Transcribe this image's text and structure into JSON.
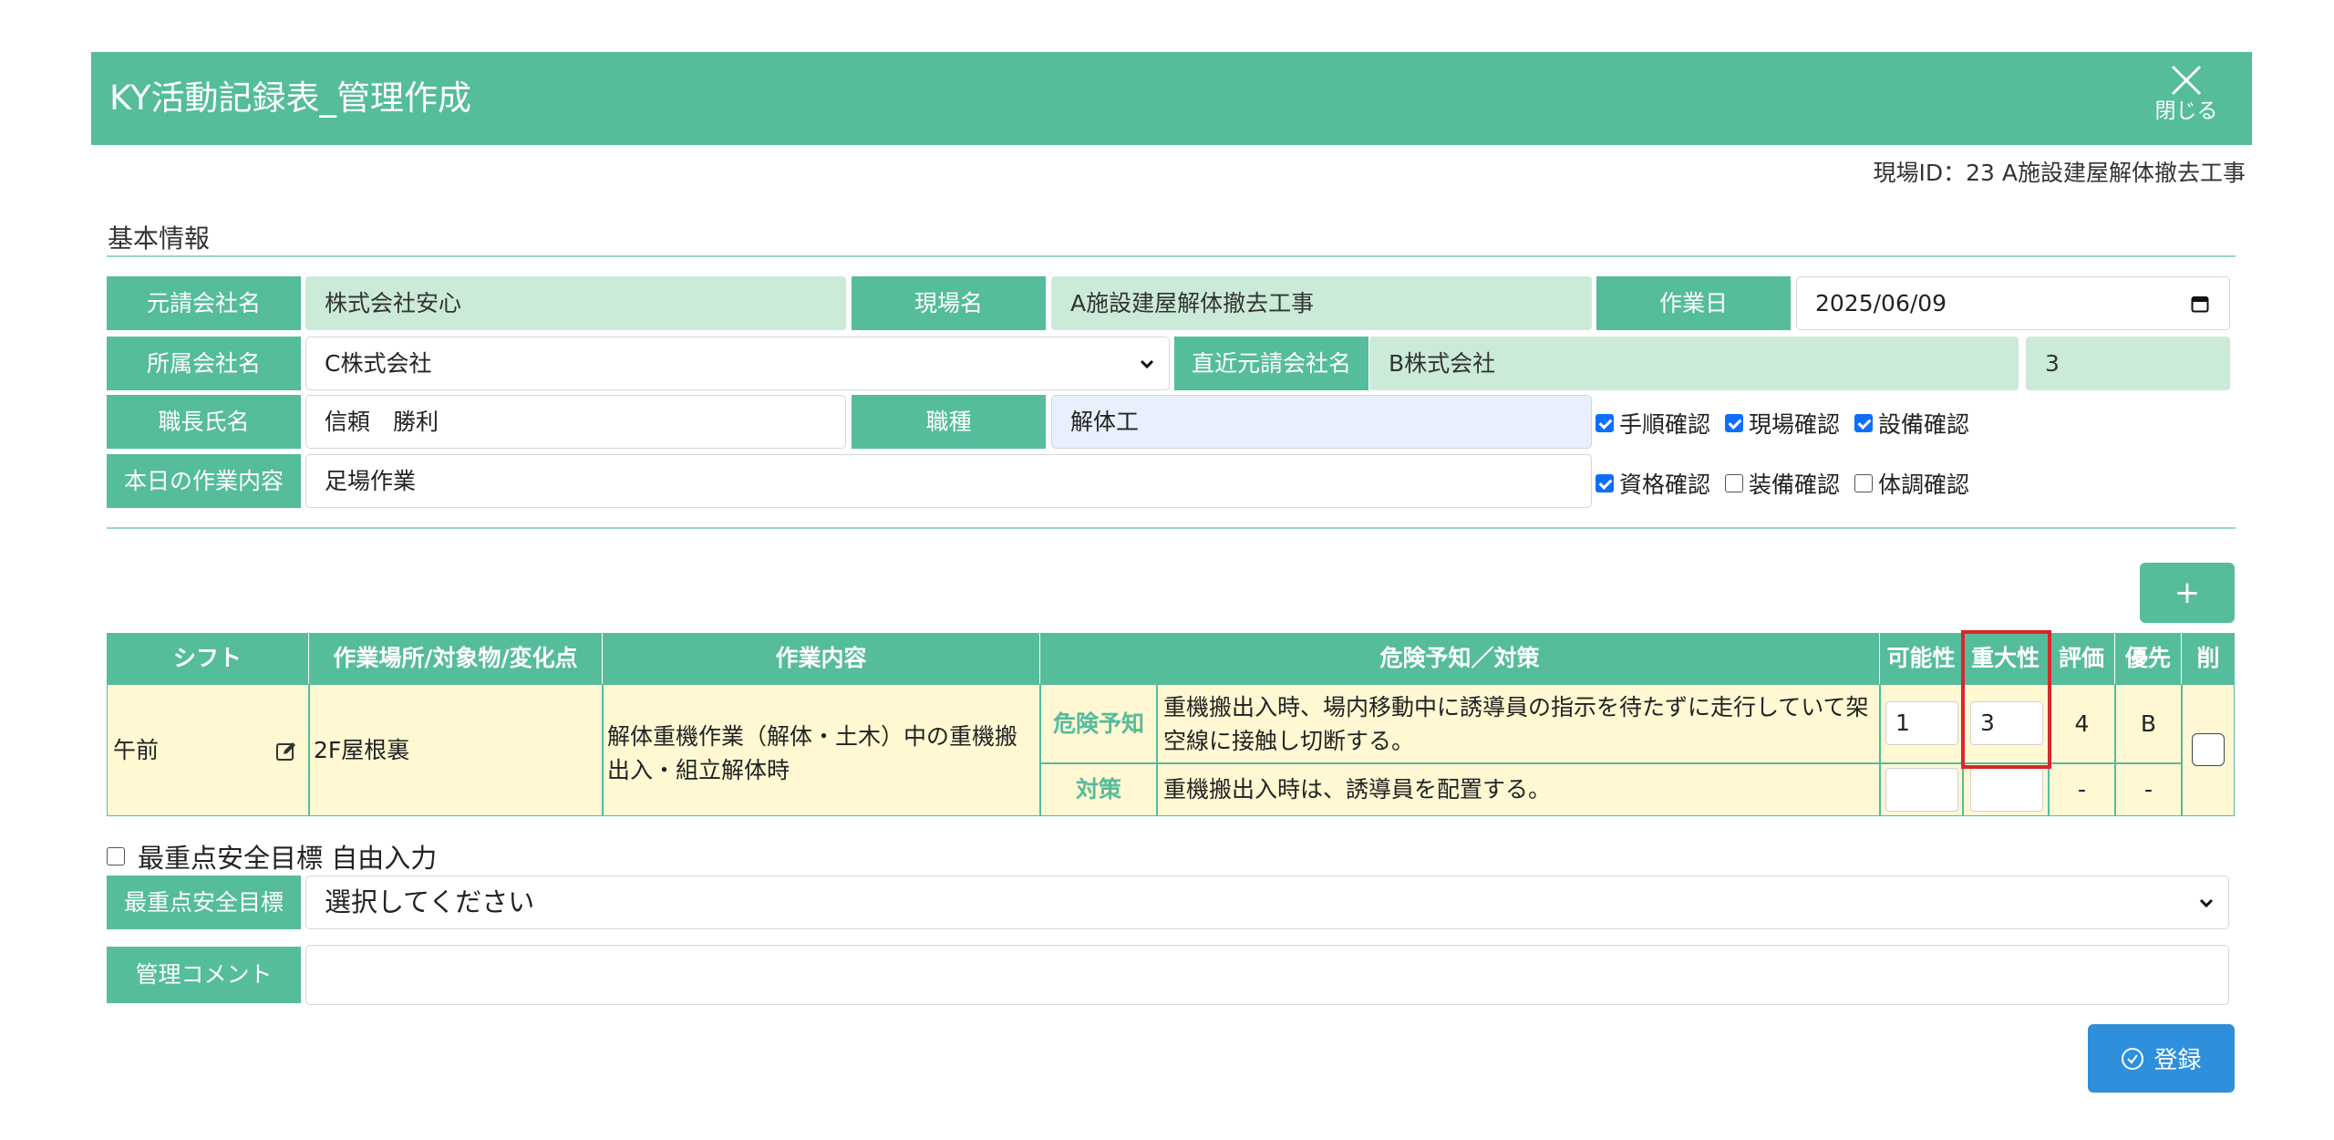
{
  "header": {
    "title": "KY活動記録表_管理作成",
    "close_label": "閉じる"
  },
  "site_id": "現場ID：23 A施設建屋解体撤去工事",
  "basic_info": {
    "section_title": "基本情報",
    "prime_contractor": {
      "label": "元請会社名",
      "value": "株式会社安心"
    },
    "site_name": {
      "label": "現場名",
      "value": "A施設建屋解体撤去工事"
    },
    "work_date": {
      "label": "作業日",
      "value": "2025/06/09"
    },
    "affiliated_company": {
      "label": "所属会社名",
      "value": "C株式会社"
    },
    "direct_prime": {
      "label": "直近元請会社名",
      "value": "B株式会社",
      "extra": "3"
    },
    "foreman": {
      "label": "職長氏名",
      "value": "信頼　勝利"
    },
    "job_type": {
      "label": "職種",
      "value": "解体工"
    },
    "work_content": {
      "label": "本日の作業内容",
      "value": "足場作業"
    },
    "checks_row1": [
      {
        "label": "手順確認",
        "checked": true
      },
      {
        "label": "現場確認",
        "checked": true
      },
      {
        "label": "設備確認",
        "checked": true
      }
    ],
    "checks_row2": [
      {
        "label": "資格確認",
        "checked": true
      },
      {
        "label": "装備確認",
        "checked": false
      },
      {
        "label": "体調確認",
        "checked": false
      }
    ]
  },
  "add_button_label": "+",
  "table": {
    "headers": {
      "shift": "シフト",
      "location": "作業場所/対象物/変化点",
      "work": "作業内容",
      "danger": "危険予知／対策",
      "possibility": "可能性",
      "severity": "重大性",
      "evaluation": "評価",
      "priority": "優先",
      "delete": "削"
    },
    "row": {
      "shift": "午前",
      "location": "2F屋根裏",
      "work": "解体重機作業（解体・土木）中の重機搬出入・組立解体時",
      "danger_label": "危険予知",
      "danger_text": "重機搬出入時、場内移動中に誘導員の指示を待たずに走行していて架空線に接触し切断する。",
      "measure_label": "対策",
      "measure_text": "重機搬出入時は、誘導員を配置する。",
      "possibility": "1",
      "severity": "3",
      "evaluation": "4",
      "priority": "B",
      "measure_evaluation": "-",
      "measure_priority": "-"
    }
  },
  "free_input_label": "最重点安全目標 自由入力",
  "top_goal": {
    "label": "最重点安全目標",
    "value": "選択してください"
  },
  "comment": {
    "label": "管理コメント",
    "value": ""
  },
  "register_label": "登録"
}
